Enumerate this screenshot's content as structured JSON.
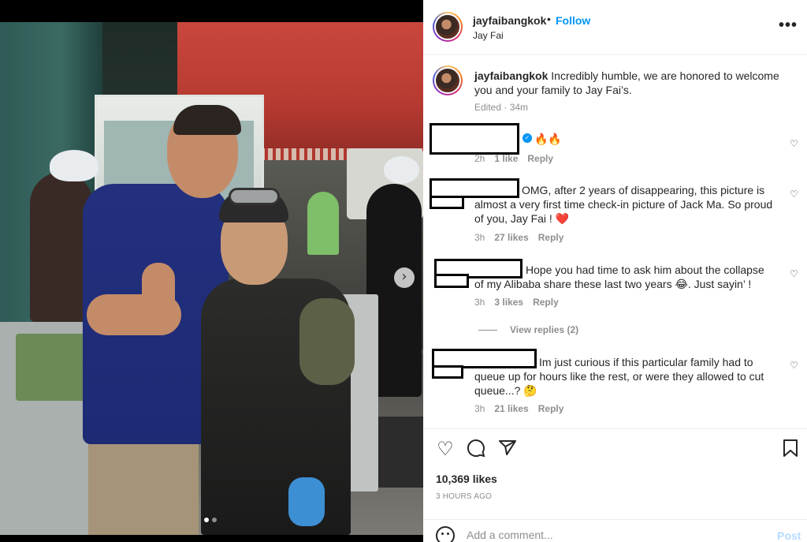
{
  "photo": {
    "next_icon": "chevron-right-icon",
    "carousel_dots": 2,
    "active_dot": 0
  },
  "header": {
    "username": "jayfaibangkok",
    "separator": "•",
    "follow_label": "Follow",
    "subtitle": "Jay Fai",
    "more_icon": "more-horizontal-icon"
  },
  "caption": {
    "username": "jayfaibangkok",
    "text": "Incredibly humble, we are honored to welcome you and your family to Jay Fai’s.",
    "edited": "Edited",
    "time": "34m"
  },
  "comments": [
    {
      "text": "🔥🔥",
      "time": "2h",
      "likes": "1 like",
      "reply": "Reply",
      "verified": true
    },
    {
      "text": "OMG, after 2 years of disappearing, this picture is almost a very first time check-in picture of Jack Ma. So proud of you, Jay Fai ! ❤️",
      "time": "3h",
      "likes": "27 likes",
      "reply": "Reply"
    },
    {
      "text": "Hope you had time to ask him about the collapse of my Alibaba share these last two years 😂. Just sayin’ !",
      "time": "3h",
      "likes": "3 likes",
      "reply": "Reply",
      "view_replies": "View replies (2)"
    },
    {
      "text": "Im just curious if this particular family had to queue up for hours like the rest, or were they allowed to cut queue...? 🤔",
      "time": "3h",
      "likes": "21 likes",
      "reply": "Reply"
    }
  ],
  "actions": {
    "like_icon": "heart-icon",
    "comment_icon": "comment-icon",
    "share_icon": "send-icon",
    "save_icon": "bookmark-icon",
    "likes": "10,369 likes",
    "posted": "3 HOURS AGO"
  },
  "add_comment": {
    "placeholder": "Add a comment...",
    "post_label": "Post"
  },
  "colors": {
    "accent": "#0095f6",
    "post_disabled": "#b3dbff",
    "muted": "#8e8e8e",
    "heart_red": "#ed4956"
  }
}
